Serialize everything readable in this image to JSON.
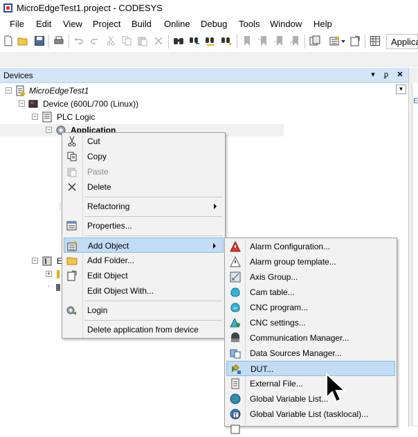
{
  "window": {
    "title": "MicroEdgeTest1.project - CODESYS"
  },
  "menubar": {
    "items": [
      "File",
      "Edit",
      "View",
      "Project",
      "Build",
      "Online",
      "Debug",
      "Tools",
      "Window",
      "Help"
    ]
  },
  "toolbar": {
    "icons": [
      "new-file-icon",
      "open-folder-icon",
      "save-icon",
      "print-icon",
      "undo-icon",
      "redo-icon",
      "cut-icon",
      "copy-icon",
      "paste-icon",
      "delete-icon",
      "find-icon",
      "find-replace-icon",
      "replace-icon",
      "replace-all-icon",
      "bookmark-icon",
      "bookmark-next-icon",
      "bookmark-prev-icon",
      "bookmark-clear-icon",
      "project-icon",
      "add-object-icon",
      "properties-icon",
      "grid-icon"
    ],
    "application_combo": "Applica"
  },
  "devices_panel": {
    "title": "Devices",
    "header_buttons": [
      "dropdown-icon",
      "pin-icon",
      "close-icon"
    ],
    "tree": {
      "project": "MicroEdgeTest1",
      "device": "Device (600L/700 (Linux))",
      "plc_logic": "PLC Logic",
      "application": "Application",
      "partial_item": "E"
    },
    "right_pane_letter": "E"
  },
  "context_menu": {
    "items": [
      {
        "label": "Cut",
        "icon": "scissors-icon",
        "enabled": true
      },
      {
        "label": "Copy",
        "icon": "copy-icon",
        "enabled": true
      },
      {
        "label": "Paste",
        "icon": "paste-icon",
        "enabled": false
      },
      {
        "label": "Delete",
        "icon": "delete-x-icon",
        "enabled": true
      },
      {
        "label": "Refactoring",
        "icon": "",
        "enabled": true,
        "submenu": true
      },
      {
        "label": "Properties...",
        "icon": "properties-icon",
        "enabled": true
      },
      {
        "label": "Add Object",
        "icon": "add-object-icon",
        "enabled": true,
        "submenu": true,
        "highlighted": true
      },
      {
        "label": "Add Folder...",
        "icon": "folder-icon",
        "enabled": true
      },
      {
        "label": "Edit Object",
        "icon": "edit-object-icon",
        "enabled": true
      },
      {
        "label": "Edit Object With...",
        "icon": "",
        "enabled": true
      },
      {
        "label": "Login",
        "icon": "login-icon",
        "enabled": true
      },
      {
        "label": "Delete application from device",
        "icon": "",
        "enabled": true
      }
    ]
  },
  "add_object_submenu": {
    "items": [
      {
        "label": "Alarm Configuration...",
        "icon": "alarm-configuration-icon"
      },
      {
        "label": "Alarm group template...",
        "icon": "alarm-group-template-icon"
      },
      {
        "label": "Axis Group...",
        "icon": "axis-group-icon"
      },
      {
        "label": "Cam table...",
        "icon": "cam-table-icon"
      },
      {
        "label": "CNC program...",
        "icon": "cnc-program-icon"
      },
      {
        "label": "CNC settings...",
        "icon": "cnc-settings-icon"
      },
      {
        "label": "Communication Manager...",
        "icon": "communication-manager-icon"
      },
      {
        "label": "Data Sources Manager...",
        "icon": "data-sources-manager-icon"
      },
      {
        "label": "DUT...",
        "icon": "dut-icon",
        "highlighted": true
      },
      {
        "label": "External File...",
        "icon": "external-file-icon"
      },
      {
        "label": "Global Variable List...",
        "icon": "global-variable-list-icon"
      },
      {
        "label": "Global Variable List (tasklocal)...",
        "icon": "global-variable-list-tasklocal-icon"
      }
    ]
  },
  "colors": {
    "panel_header": "#d4e5f7",
    "menu_background": "#f2f2f2",
    "menu_highlight": "#c2dcf4",
    "menu_highlight_border": "#90b8e2",
    "disabled_text": "#8d8d8d"
  }
}
